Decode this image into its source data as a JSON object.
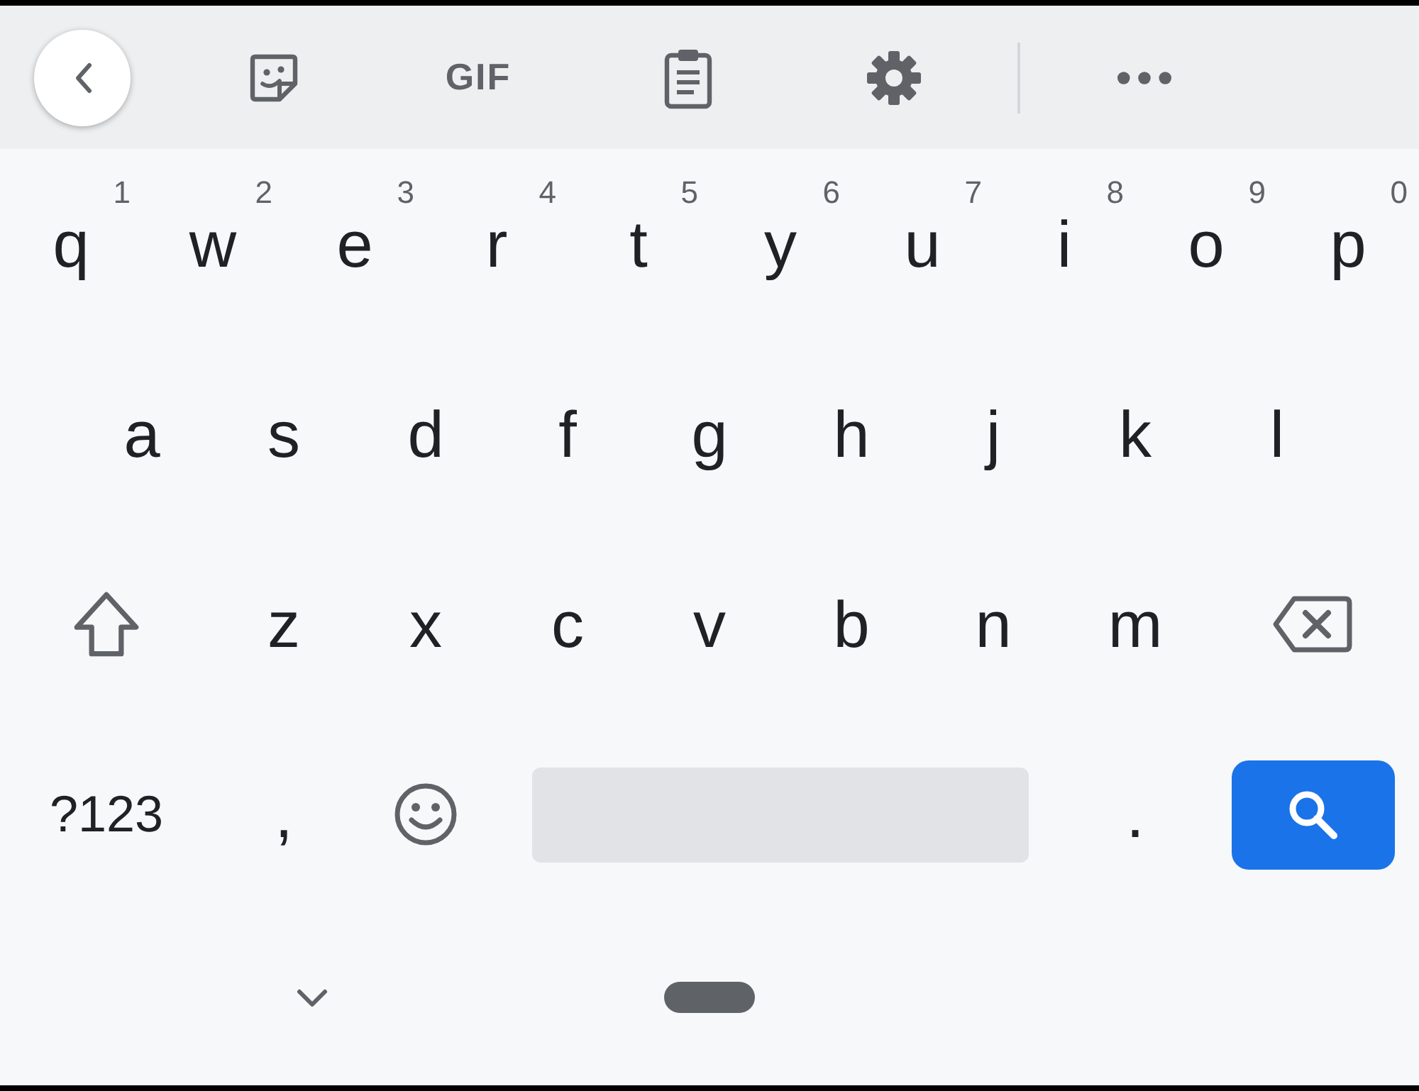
{
  "toolbar": {
    "items": [
      {
        "kind": "back"
      },
      {
        "kind": "sticker"
      },
      {
        "kind": "gif",
        "label": "GIF"
      },
      {
        "kind": "clipboard"
      },
      {
        "kind": "settings"
      },
      {
        "kind": "divider"
      },
      {
        "kind": "more"
      }
    ]
  },
  "rows": [
    {
      "keys": [
        {
          "kind": "char",
          "label": "q",
          "hint": "1"
        },
        {
          "kind": "char",
          "label": "w",
          "hint": "2"
        },
        {
          "kind": "char",
          "label": "e",
          "hint": "3"
        },
        {
          "kind": "char",
          "label": "r",
          "hint": "4"
        },
        {
          "kind": "char",
          "label": "t",
          "hint": "5"
        },
        {
          "kind": "char",
          "label": "y",
          "hint": "6"
        },
        {
          "kind": "char",
          "label": "u",
          "hint": "7"
        },
        {
          "kind": "char",
          "label": "i",
          "hint": "8"
        },
        {
          "kind": "char",
          "label": "o",
          "hint": "9"
        },
        {
          "kind": "char",
          "label": "p",
          "hint": "0"
        }
      ]
    },
    {
      "keys": [
        {
          "kind": "char",
          "label": "a"
        },
        {
          "kind": "char",
          "label": "s"
        },
        {
          "kind": "char",
          "label": "d"
        },
        {
          "kind": "char",
          "label": "f"
        },
        {
          "kind": "char",
          "label": "g"
        },
        {
          "kind": "char",
          "label": "h"
        },
        {
          "kind": "char",
          "label": "j"
        },
        {
          "kind": "char",
          "label": "k"
        },
        {
          "kind": "char",
          "label": "l"
        }
      ]
    },
    {
      "keys": [
        {
          "kind": "shift"
        },
        {
          "kind": "char",
          "label": "z"
        },
        {
          "kind": "char",
          "label": "x"
        },
        {
          "kind": "char",
          "label": "c"
        },
        {
          "kind": "char",
          "label": "v"
        },
        {
          "kind": "char",
          "label": "b"
        },
        {
          "kind": "char",
          "label": "n"
        },
        {
          "kind": "char",
          "label": "m"
        },
        {
          "kind": "backspace"
        }
      ]
    },
    {
      "keys": [
        {
          "kind": "symbols",
          "label": "?123"
        },
        {
          "kind": "char",
          "label": ","
        },
        {
          "kind": "emoji"
        },
        {
          "kind": "space"
        },
        {
          "kind": "char",
          "label": "."
        },
        {
          "kind": "search"
        }
      ]
    }
  ]
}
